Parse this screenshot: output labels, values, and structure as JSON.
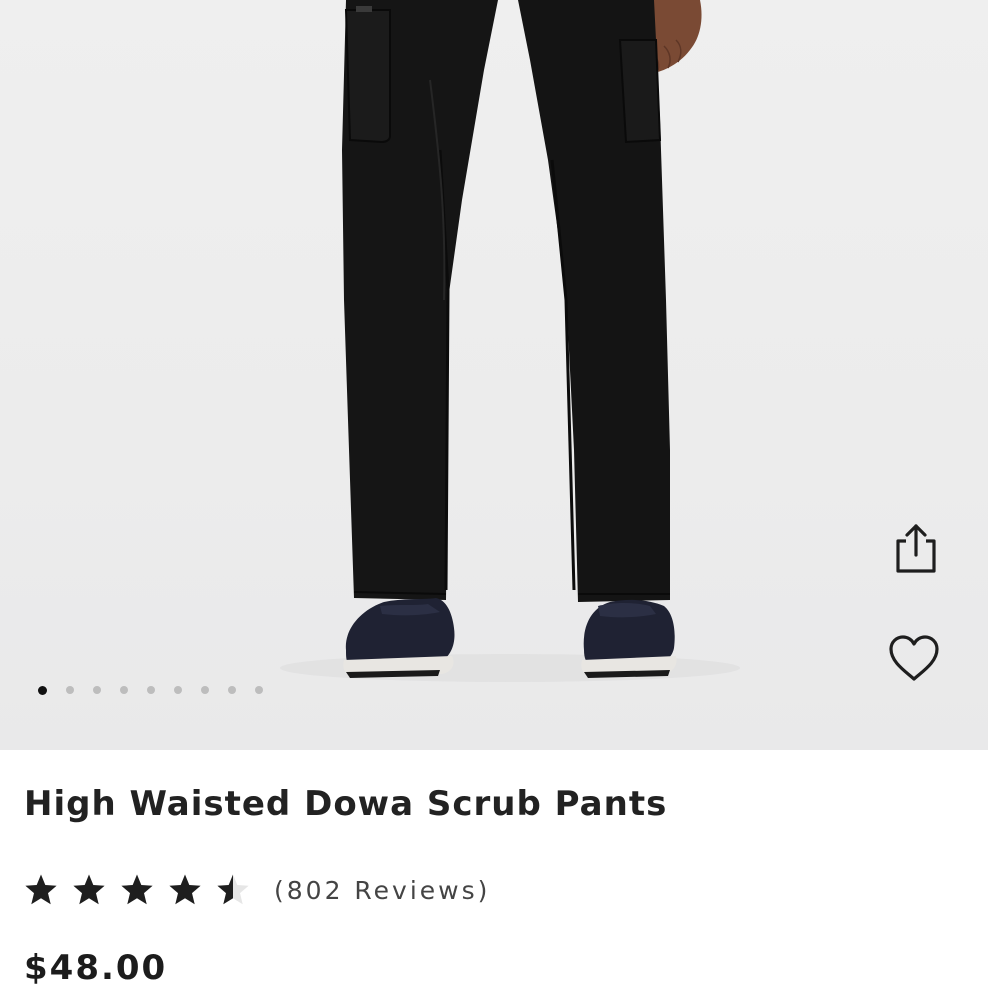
{
  "product": {
    "title": "High Waisted Dowa Scrub Pants",
    "rating": 4.5,
    "rating_max": 5,
    "reviews_label": "(802 Reviews)",
    "price": "$48.00"
  },
  "gallery": {
    "image_subject": "black scrub pants worn with dark sneakers",
    "slide_count": 9,
    "active_slide": 1
  },
  "actions": {
    "share_icon": "share-icon",
    "favorite_icon": "heart-outline-icon"
  },
  "colors": {
    "background": "#ffffff",
    "hero_background": "#eeeeee",
    "pants": "#141414",
    "text": "#222222",
    "dot_active": "#111111",
    "dot_inactive": "#bdbdbd"
  }
}
